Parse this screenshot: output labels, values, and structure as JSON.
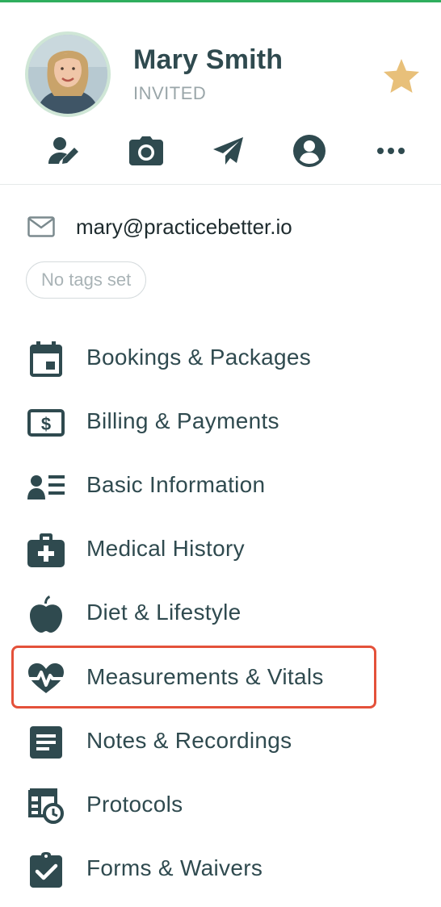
{
  "client": {
    "name": "Mary Smith",
    "status": "INVITED",
    "favorite": true
  },
  "quick_actions": [
    {
      "icon": "edit-user-icon"
    },
    {
      "icon": "camera-icon"
    },
    {
      "icon": "send-icon"
    },
    {
      "icon": "account-icon"
    },
    {
      "icon": "more-icon"
    }
  ],
  "contact": {
    "email": "mary@practicebetter.io"
  },
  "tags": {
    "empty_label": "No tags set"
  },
  "menu": {
    "items": [
      {
        "label": "Bookings & Packages",
        "icon": "calendar-icon"
      },
      {
        "label": "Billing & Payments",
        "icon": "billing-icon"
      },
      {
        "label": "Basic Information",
        "icon": "contact-card-icon"
      },
      {
        "label": "Medical History",
        "icon": "medical-kit-icon"
      },
      {
        "label": "Diet & Lifestyle",
        "icon": "apple-icon"
      },
      {
        "label": "Measurements & Vitals",
        "icon": "heartbeat-icon"
      },
      {
        "label": "Notes & Recordings",
        "icon": "notes-icon"
      },
      {
        "label": "Protocols",
        "icon": "protocols-icon"
      },
      {
        "label": "Forms & Waivers",
        "icon": "clipboard-check-icon"
      }
    ],
    "selected_index": 5
  },
  "colors": {
    "text": "#2f4a4f",
    "accent_star": "#e8c07a",
    "selection_border": "#e4513a",
    "top_accent": "#2fae5e"
  }
}
